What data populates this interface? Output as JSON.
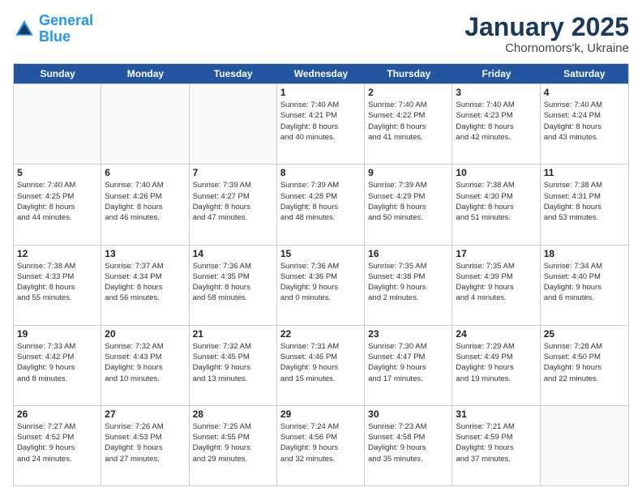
{
  "logo": {
    "line1": "General",
    "line2": "Blue"
  },
  "title": "January 2025",
  "subtitle": "Chornomors'k, Ukraine",
  "header_days": [
    "Sunday",
    "Monday",
    "Tuesday",
    "Wednesday",
    "Thursday",
    "Friday",
    "Saturday"
  ],
  "weeks": [
    [
      {
        "day": "",
        "info": ""
      },
      {
        "day": "",
        "info": ""
      },
      {
        "day": "",
        "info": ""
      },
      {
        "day": "1",
        "info": "Sunrise: 7:40 AM\nSunset: 4:21 PM\nDaylight: 8 hours\nand 40 minutes."
      },
      {
        "day": "2",
        "info": "Sunrise: 7:40 AM\nSunset: 4:22 PM\nDaylight: 8 hours\nand 41 minutes."
      },
      {
        "day": "3",
        "info": "Sunrise: 7:40 AM\nSunset: 4:23 PM\nDaylight: 8 hours\nand 42 minutes."
      },
      {
        "day": "4",
        "info": "Sunrise: 7:40 AM\nSunset: 4:24 PM\nDaylight: 8 hours\nand 43 minutes."
      }
    ],
    [
      {
        "day": "5",
        "info": "Sunrise: 7:40 AM\nSunset: 4:25 PM\nDaylight: 8 hours\nand 44 minutes."
      },
      {
        "day": "6",
        "info": "Sunrise: 7:40 AM\nSunset: 4:26 PM\nDaylight: 8 hours\nand 46 minutes."
      },
      {
        "day": "7",
        "info": "Sunrise: 7:39 AM\nSunset: 4:27 PM\nDaylight: 8 hours\nand 47 minutes."
      },
      {
        "day": "8",
        "info": "Sunrise: 7:39 AM\nSunset: 4:28 PM\nDaylight: 8 hours\nand 48 minutes."
      },
      {
        "day": "9",
        "info": "Sunrise: 7:39 AM\nSunset: 4:29 PM\nDaylight: 8 hours\nand 50 minutes."
      },
      {
        "day": "10",
        "info": "Sunrise: 7:38 AM\nSunset: 4:30 PM\nDaylight: 8 hours\nand 51 minutes."
      },
      {
        "day": "11",
        "info": "Sunrise: 7:38 AM\nSunset: 4:31 PM\nDaylight: 8 hours\nand 53 minutes."
      }
    ],
    [
      {
        "day": "12",
        "info": "Sunrise: 7:38 AM\nSunset: 4:33 PM\nDaylight: 8 hours\nand 55 minutes."
      },
      {
        "day": "13",
        "info": "Sunrise: 7:37 AM\nSunset: 4:34 PM\nDaylight: 8 hours\nand 56 minutes."
      },
      {
        "day": "14",
        "info": "Sunrise: 7:36 AM\nSunset: 4:35 PM\nDaylight: 8 hours\nand 58 minutes."
      },
      {
        "day": "15",
        "info": "Sunrise: 7:36 AM\nSunset: 4:36 PM\nDaylight: 9 hours\nand 0 minutes."
      },
      {
        "day": "16",
        "info": "Sunrise: 7:35 AM\nSunset: 4:38 PM\nDaylight: 9 hours\nand 2 minutes."
      },
      {
        "day": "17",
        "info": "Sunrise: 7:35 AM\nSunset: 4:39 PM\nDaylight: 9 hours\nand 4 minutes."
      },
      {
        "day": "18",
        "info": "Sunrise: 7:34 AM\nSunset: 4:40 PM\nDaylight: 9 hours\nand 6 minutes."
      }
    ],
    [
      {
        "day": "19",
        "info": "Sunrise: 7:33 AM\nSunset: 4:42 PM\nDaylight: 9 hours\nand 8 minutes."
      },
      {
        "day": "20",
        "info": "Sunrise: 7:32 AM\nSunset: 4:43 PM\nDaylight: 9 hours\nand 10 minutes."
      },
      {
        "day": "21",
        "info": "Sunrise: 7:32 AM\nSunset: 4:45 PM\nDaylight: 9 hours\nand 13 minutes."
      },
      {
        "day": "22",
        "info": "Sunrise: 7:31 AM\nSunset: 4:46 PM\nDaylight: 9 hours\nand 15 minutes."
      },
      {
        "day": "23",
        "info": "Sunrise: 7:30 AM\nSunset: 4:47 PM\nDaylight: 9 hours\nand 17 minutes."
      },
      {
        "day": "24",
        "info": "Sunrise: 7:29 AM\nSunset: 4:49 PM\nDaylight: 9 hours\nand 19 minutes."
      },
      {
        "day": "25",
        "info": "Sunrise: 7:28 AM\nSunset: 4:50 PM\nDaylight: 9 hours\nand 22 minutes."
      }
    ],
    [
      {
        "day": "26",
        "info": "Sunrise: 7:27 AM\nSunset: 4:52 PM\nDaylight: 9 hours\nand 24 minutes."
      },
      {
        "day": "27",
        "info": "Sunrise: 7:26 AM\nSunset: 4:53 PM\nDaylight: 9 hours\nand 27 minutes."
      },
      {
        "day": "28",
        "info": "Sunrise: 7:25 AM\nSunset: 4:55 PM\nDaylight: 9 hours\nand 29 minutes."
      },
      {
        "day": "29",
        "info": "Sunrise: 7:24 AM\nSunset: 4:56 PM\nDaylight: 9 hours\nand 32 minutes."
      },
      {
        "day": "30",
        "info": "Sunrise: 7:23 AM\nSunset: 4:58 PM\nDaylight: 9 hours\nand 35 minutes."
      },
      {
        "day": "31",
        "info": "Sunrise: 7:21 AM\nSunset: 4:59 PM\nDaylight: 9 hours\nand 37 minutes."
      },
      {
        "day": "",
        "info": ""
      }
    ]
  ]
}
